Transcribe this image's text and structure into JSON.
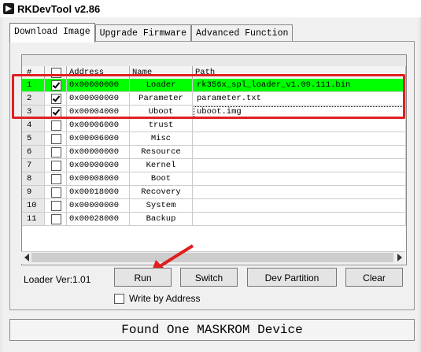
{
  "window": {
    "title": "RKDevTool v2.86"
  },
  "tabs": [
    {
      "label": "Download Image"
    },
    {
      "label": "Upgrade Firmware"
    },
    {
      "label": "Advanced Function"
    }
  ],
  "table": {
    "headers": {
      "num": "#",
      "address": "Address",
      "name": "Name",
      "path": "Path"
    },
    "rows": [
      {
        "num": "1",
        "checked": true,
        "address": "0x00000000",
        "name": "Loader",
        "path": "rk356x_spl_loader_v1.09.111.bin"
      },
      {
        "num": "2",
        "checked": true,
        "address": "0x00000000",
        "name": "Parameter",
        "path": "parameter.txt"
      },
      {
        "num": "3",
        "checked": true,
        "address": "0x00004000",
        "name": "Uboot",
        "path": "uboot.img"
      },
      {
        "num": "4",
        "checked": false,
        "address": "0x00006000",
        "name": "trust",
        "path": ""
      },
      {
        "num": "5",
        "checked": false,
        "address": "0x00006000",
        "name": "Misc",
        "path": ""
      },
      {
        "num": "6",
        "checked": false,
        "address": "0x00000000",
        "name": "Resource",
        "path": ""
      },
      {
        "num": "7",
        "checked": false,
        "address": "0x00000000",
        "name": "Kernel",
        "path": ""
      },
      {
        "num": "8",
        "checked": false,
        "address": "0x00008000",
        "name": "Boot",
        "path": ""
      },
      {
        "num": "9",
        "checked": false,
        "address": "0x00018000",
        "name": "Recovery",
        "path": ""
      },
      {
        "num": "10",
        "checked": false,
        "address": "0x00000000",
        "name": "System",
        "path": ""
      },
      {
        "num": "11",
        "checked": false,
        "address": "0x00028000",
        "name": "Backup",
        "path": ""
      }
    ]
  },
  "controls": {
    "loader_version": "Loader Ver:1.01",
    "run": "Run",
    "switch": "Switch",
    "dev_partition": "Dev Partition",
    "clear": "Clear",
    "write_by_address": "Write by Address"
  },
  "status": "Found One MASKROM Device",
  "colors": {
    "highlight": "#00ff00",
    "annotation": "#e02020"
  }
}
